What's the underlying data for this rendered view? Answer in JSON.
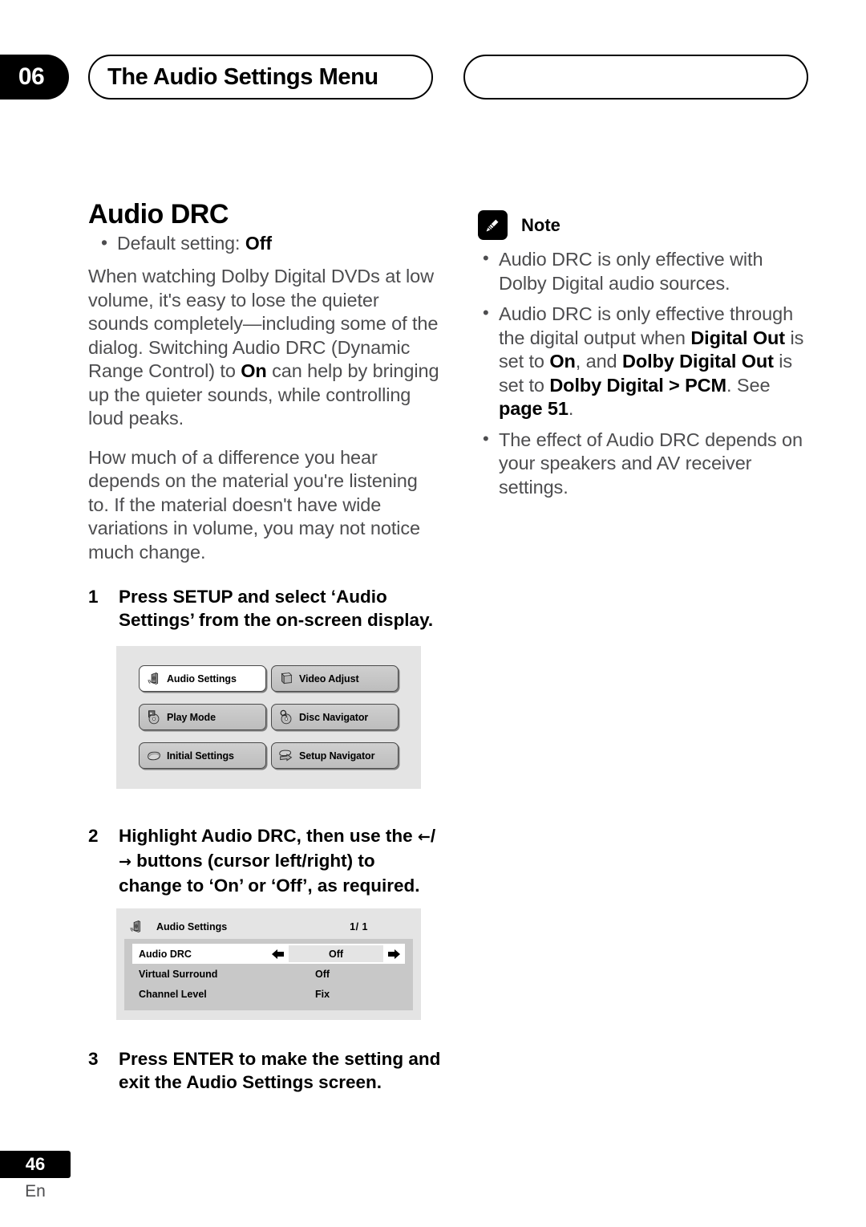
{
  "header": {
    "chapter_number": "06",
    "chapter_title": "The Audio Settings Menu",
    "right_pill_text": ""
  },
  "left_column": {
    "section_title": "Audio DRC",
    "default_setting_prefix": "Default setting: ",
    "default_setting_value": "Off",
    "paragraph_1_a": "When watching Dolby Digital DVDs at low volume, it's easy to lose the quieter sounds completely—including some of the dialog. Switching Audio DRC (Dynamic Range Control) to ",
    "paragraph_1_b": "On",
    "paragraph_1_c": " can help by bringing up the quieter sounds, while controlling loud peaks.",
    "paragraph_2": "How much of a difference you hear depends on the material you're listening to. If the material doesn't have wide variations in volume, you may not notice much change.",
    "steps": [
      {
        "number": "1",
        "text": "Press SETUP and select ‘Audio Settings’ from the on-screen display."
      },
      {
        "number": "2",
        "prefix": "Highlight Audio DRC, then use the ",
        "arrow_left": "←",
        "arrow_sep": "/",
        "arrow_right": "→",
        "suffix": " buttons (cursor left/right) to change to ‘On’ or ‘Off’, as required."
      },
      {
        "number": "3",
        "text": "Press ENTER to make the setting and exit the Audio Settings screen."
      }
    ]
  },
  "osd_menu": {
    "items": [
      {
        "label": "Audio Settings",
        "icon": "speaker-icon",
        "selected": true
      },
      {
        "label": "Video Adjust",
        "icon": "monitor-icon",
        "selected": false
      },
      {
        "label": "Play Mode",
        "icon": "disc-flag-icon",
        "selected": false
      },
      {
        "label": "Disc Navigator",
        "icon": "disc-magnifier-icon",
        "selected": false
      },
      {
        "label": "Initial Settings",
        "icon": "disc-tray-icon",
        "selected": false
      },
      {
        "label": "Setup Navigator",
        "icon": "setup-arrow-icon",
        "selected": false
      }
    ]
  },
  "audio_settings_panel": {
    "title": "Audio Settings",
    "icon": "speaker-icon",
    "page_indicator": "1/ 1",
    "rows": [
      {
        "label": "Audio DRC",
        "value": "Off",
        "selected": true
      },
      {
        "label": "Virtual Surround",
        "value": "Off",
        "selected": false
      },
      {
        "label": "Channel Level",
        "value": "Fix",
        "selected": false
      }
    ]
  },
  "note": {
    "icon": "pencil-icon",
    "label": "Note",
    "items": [
      {
        "a": "Audio DRC is only effective with Dolby Digital audio sources."
      },
      {
        "a": "Audio DRC is only effective through the digital output when ",
        "b1": "Digital Out",
        "c": " is set to ",
        "b2": "On",
        "d": ", and ",
        "b3": "Dolby Digital Out",
        "e": " is set to ",
        "b4": "Dolby Digital > PCM",
        "f": ". See ",
        "b5": "page 51",
        "g": "."
      },
      {
        "a": "The effect of Audio DRC depends on your speakers and AV receiver settings."
      }
    ]
  },
  "footer": {
    "page_number": "46",
    "language_code": "En"
  },
  "colors": {
    "black": "#000000",
    "body_text": "#4d4d4f",
    "osd_background": "#e4e4e4",
    "osd_list_background": "#c8c8c8",
    "osd_button": "#c6c6c6",
    "osd_button_selected": "#ffffff"
  }
}
